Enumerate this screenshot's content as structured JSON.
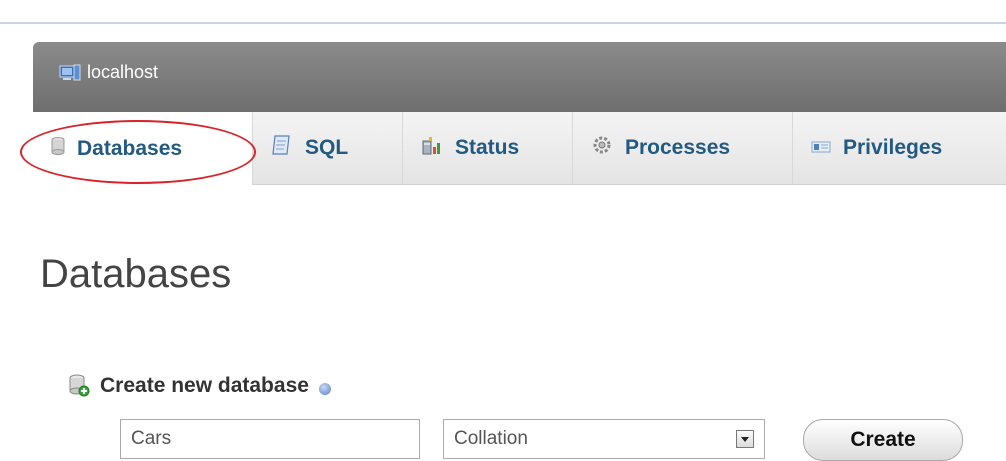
{
  "server": {
    "label": "localhost",
    "icon": "server-icon"
  },
  "tabs": [
    {
      "label": "Databases",
      "icon": "database-icon",
      "active": true
    },
    {
      "label": "SQL",
      "icon": "sql-icon",
      "active": false
    },
    {
      "label": "Status",
      "icon": "status-icon",
      "active": false
    },
    {
      "label": "Processes",
      "icon": "processes-icon",
      "active": false
    },
    {
      "label": "Privileges",
      "icon": "privileges-icon",
      "active": false
    }
  ],
  "page": {
    "title": "Databases"
  },
  "create_db": {
    "heading": "Create new database",
    "name_value": "Cars",
    "collation_label": "Collation",
    "create_label": "Create"
  },
  "colors": {
    "tab_text": "#235a81",
    "highlight_circle": "#d8232a",
    "serverbar": "#7a7a7a"
  }
}
